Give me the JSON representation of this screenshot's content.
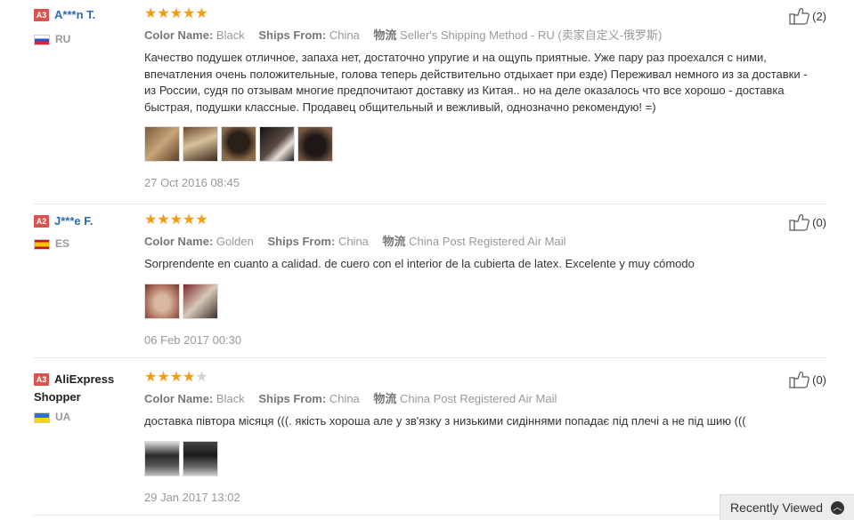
{
  "reviews": [
    {
      "badge": "A3",
      "name": "A***n T.",
      "country": "RU",
      "rating": 5,
      "attrs": [
        {
          "label": "Color Name:",
          "value": "Black"
        },
        {
          "label": "Ships From:",
          "value": "China"
        },
        {
          "label": "物流",
          "value": "Seller's Shipping Method - RU (卖家自定义-俄罗斯)"
        }
      ],
      "text": "Качество подушек отличное, запаха нет, достаточно упругие и на ощупь приятные. Уже пару раз проехался с ними, впечатления очень положительные, голова теперь действительно отдыхает при езде) Переживал немного из за доставки - из России, судя по отзывам многие предпочитают доставку из Китая.. но на деле оказалось что все хорошо - доставка быстрая, подушки классные. Продавец общительный и вежливый, однозначно рекомендую! =)",
      "date": "27 Oct 2016 08:45",
      "helpful": "(2)"
    },
    {
      "badge": "A2",
      "name": "J***e F.",
      "country": "ES",
      "rating": 5,
      "attrs": [
        {
          "label": "Color Name:",
          "value": "Golden"
        },
        {
          "label": "Ships From:",
          "value": "China"
        },
        {
          "label": "物流",
          "value": "China Post Registered Air Mail"
        }
      ],
      "text": "Sorprendente en cuanto a calidad. de cuero con el interior de la cubierta de latex. Excelente y muy cómodo",
      "date": "06 Feb 2017 00:30",
      "helpful": "(0)"
    },
    {
      "badge": "A3",
      "name": "AliExpress Shopper",
      "country": "UA",
      "rating": 4,
      "attrs": [
        {
          "label": "Color Name:",
          "value": "Black"
        },
        {
          "label": "Ships From:",
          "value": "China"
        },
        {
          "label": "物流",
          "value": "China Post Registered Air Mail"
        }
      ],
      "text": "доставка півтора місяця (((. якість хороша але у зв'язку з низькими сидіннями попадає під плечі а не під шию (((",
      "date": "29 Jan 2017 13:02",
      "helpful": "(0)"
    }
  ],
  "recently_viewed": "Recently Viewed",
  "colors": {
    "star": "#f39c12",
    "link": "#2b6cb0",
    "badge": "#d9534f"
  }
}
